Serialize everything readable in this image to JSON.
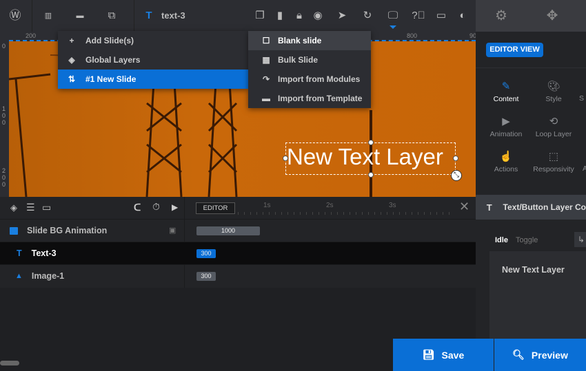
{
  "topbar": {
    "layer_name": "text-3",
    "icons": [
      "wordpress-icon",
      "slides-icon",
      "layer-image-icon",
      "add-layer-icon",
      "duplicate-icon",
      "trash-icon",
      "lock-icon",
      "eye-icon",
      "cursor-icon",
      "undo-icon",
      "desktop-icon",
      "help-icon",
      "comment-icon",
      "contrast-icon",
      "gear-icon",
      "gamepad-icon"
    ]
  },
  "ruler": {
    "top": [
      "200",
      "800",
      "90"
    ],
    "left": [
      "0",
      "1\n0\n0",
      "2\n0\n0"
    ]
  },
  "canvas": {
    "text_layer": "New Text Layer"
  },
  "slide_menu": {
    "items": [
      {
        "icon": "plus-icon",
        "label": "Add Slide(s)"
      },
      {
        "icon": "layers-icon",
        "label": "Global Layers"
      },
      {
        "icon": "sort-icon",
        "label": "#1 New Slide",
        "active": true
      }
    ]
  },
  "add_menu": {
    "items": [
      {
        "icon": "square-icon",
        "label": "Blank slide"
      },
      {
        "icon": "grid-icon",
        "label": "Bulk Slide"
      },
      {
        "icon": "redo-arrow-icon",
        "label": "Import from Modules"
      },
      {
        "icon": "folder-icon",
        "label": "Import from Template"
      }
    ]
  },
  "right_panel": {
    "editor_view": "EDITOR VIEW",
    "tabs": [
      {
        "label": "Content",
        "active": true
      },
      {
        "label": "Style"
      },
      {
        "label": "S"
      },
      {
        "label": "Animation"
      },
      {
        "label": "Loop Layer"
      },
      {
        "label": "Actions"
      },
      {
        "label": "Responsivity"
      },
      {
        "label": "A"
      }
    ],
    "section_title": "Text/Button Layer Co",
    "states": [
      "Idle",
      "Toggle"
    ],
    "content_text": "New Text Layer"
  },
  "timeline": {
    "editor_label": "EDITOR",
    "ticks": [
      "1s",
      "2s",
      "3s"
    ],
    "rows": [
      {
        "name": "Slide BG Animation",
        "value": "1000"
      },
      {
        "name": "Text-3",
        "value": "300"
      },
      {
        "name": "Image-1",
        "value": "300"
      }
    ]
  },
  "footer": {
    "save": "Save",
    "preview": "Preview"
  },
  "colors": {
    "accent": "#0a6fd6",
    "canvas": "#c56508"
  }
}
